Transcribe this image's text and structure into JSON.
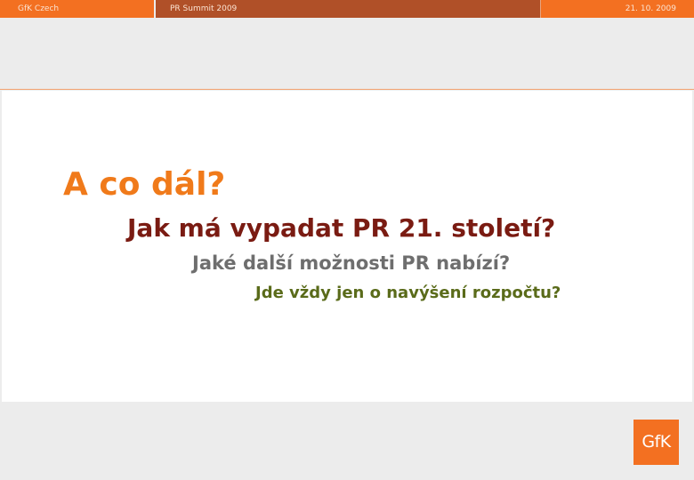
{
  "header": {
    "left_label": "GfK Czech",
    "center_label": "PR Summit 2009",
    "date": "21. 10. 2009"
  },
  "slide": {
    "heading": "A co dál?",
    "line2": "Jak má vypadat PR 21. století?",
    "line3": "Jaké další možnosti PR nabízí?",
    "line4": "Jde vždy jen o navýšení rozpočtu?"
  },
  "logo": {
    "text": "GfK"
  },
  "colors": {
    "brand_orange": "#f37021",
    "header_brown": "#b05028",
    "heading_orange": "#f07a1a",
    "line2_maroon": "#7a1b12",
    "line3_gray": "#6e6e6e",
    "line4_olive": "#5a6b1a"
  }
}
